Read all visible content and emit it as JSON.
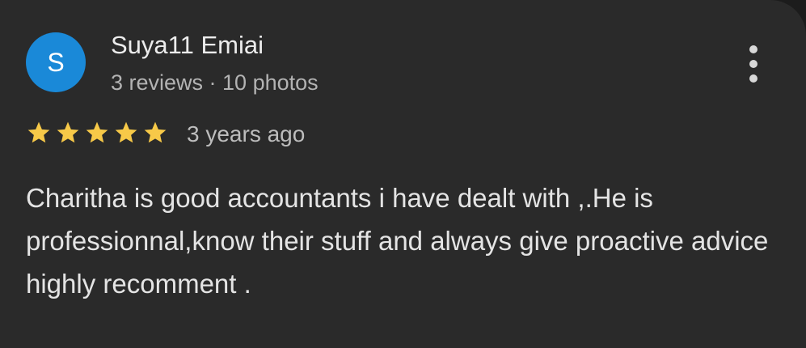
{
  "review": {
    "avatar_letter": "S",
    "author_name": "Suya11 Emiai",
    "author_meta": "3 reviews · 10 photos",
    "rating": 5,
    "rating_max": 5,
    "time_ago": "3 years ago",
    "text": "Charitha is good accountants i have dealt with ,.He is professionnal,know their stuff and always give proactive advice highly recomment ."
  },
  "icons": {
    "more": "more-vert-icon",
    "star": "star-icon"
  },
  "colors": {
    "card_background": "#2a2a2a",
    "avatar": "#1a89d8",
    "star": "#f7c948"
  }
}
